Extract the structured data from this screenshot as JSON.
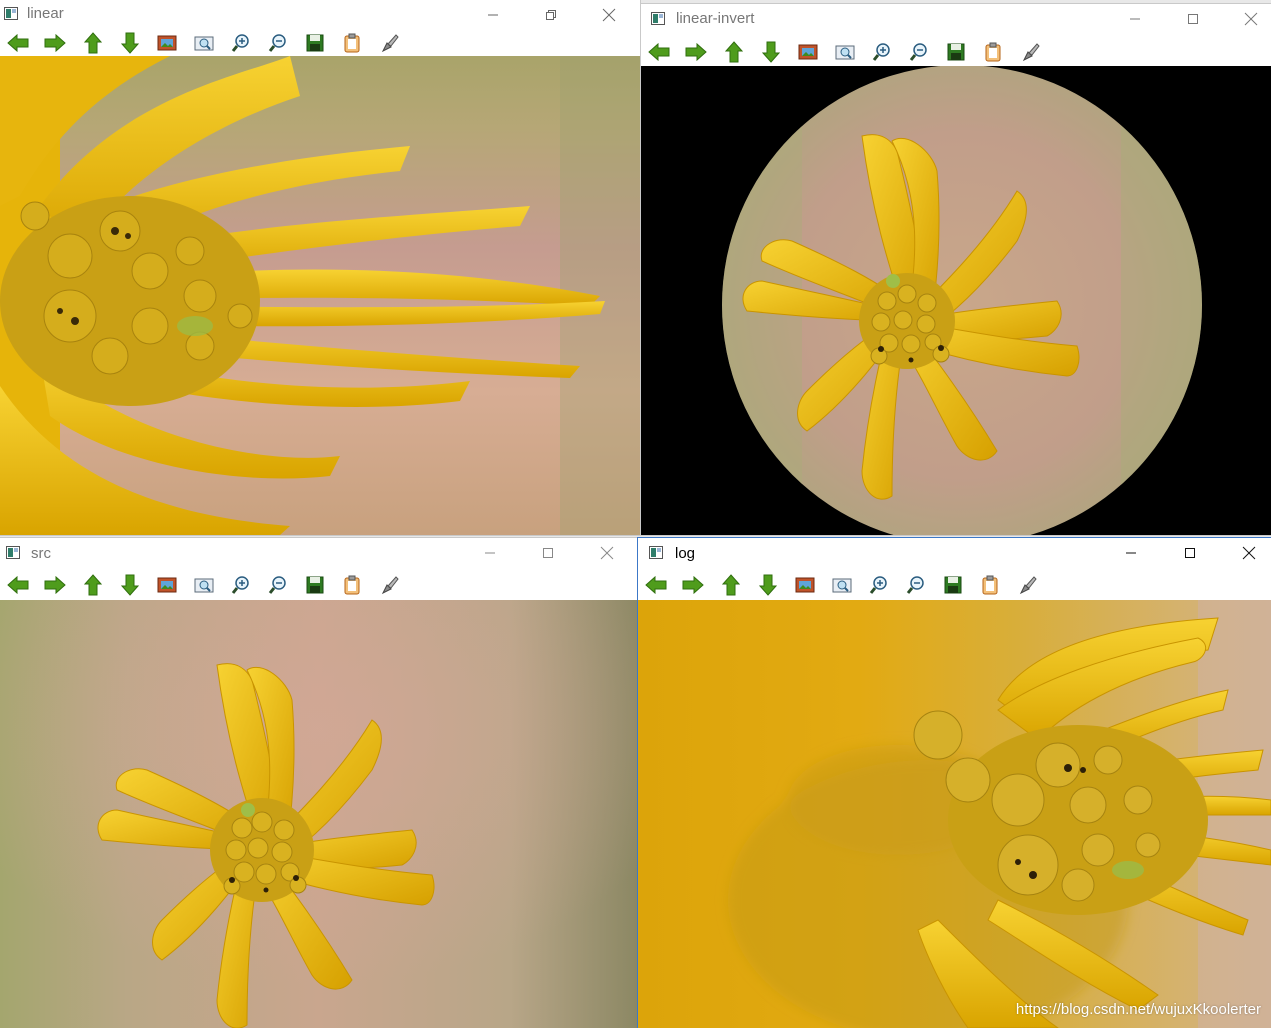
{
  "windows": {
    "linear": {
      "title": "linear",
      "state": "inactive"
    },
    "linear_invert": {
      "title": "linear-invert",
      "state": "inactive"
    },
    "src": {
      "title": "src",
      "state": "inactive"
    },
    "log": {
      "title": "log",
      "state": "active"
    }
  },
  "toolbar_icons": [
    "arrow-left-icon",
    "arrow-right-icon",
    "arrow-up-icon",
    "arrow-down-icon",
    "image-icon",
    "zoom-fit-icon",
    "zoom-in-icon",
    "zoom-out-icon",
    "save-icon",
    "copy-icon",
    "properties-icon"
  ],
  "colors": {
    "petal": "#e8bd0a",
    "petal_dark": "#c99400",
    "center": "#b99a10",
    "bg_pink": "#c9a090",
    "bg_green": "#a7ad74",
    "icon_green": "#4f9c1c"
  },
  "watermark": "https://blog.csdn.net/wujuxKkoolerter"
}
